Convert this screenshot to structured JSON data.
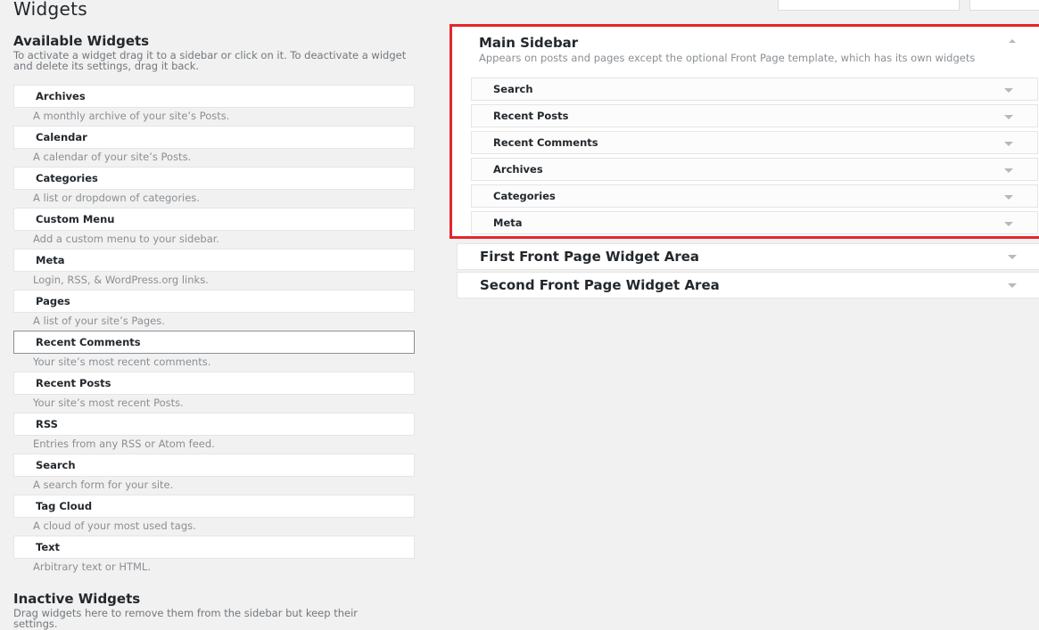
{
  "page": {
    "title": "Widgets"
  },
  "available": {
    "heading": "Available Widgets",
    "description": "To activate a widget drag it to a sidebar or click on it. To deactivate a widget and delete its settings, drag it back.",
    "widgets": [
      {
        "name": "Archives",
        "description": "A monthly archive of your site’s Posts."
      },
      {
        "name": "Calendar",
        "description": "A calendar of your site’s Posts."
      },
      {
        "name": "Categories",
        "description": "A list or dropdown of categories."
      },
      {
        "name": "Custom Menu",
        "description": "Add a custom menu to your sidebar."
      },
      {
        "name": "Meta",
        "description": "Login, RSS, & WordPress.org links."
      },
      {
        "name": "Pages",
        "description": "A list of your site’s Pages."
      },
      {
        "name": "Recent Comments",
        "description": "Your site’s most recent comments."
      },
      {
        "name": "Recent Posts",
        "description": "Your site’s most recent Posts."
      },
      {
        "name": "RSS",
        "description": "Entries from any RSS or Atom feed."
      },
      {
        "name": "Search",
        "description": "A search form for your site."
      },
      {
        "name": "Tag Cloud",
        "description": "A cloud of your most used tags."
      },
      {
        "name": "Text",
        "description": "Arbitrary text or HTML."
      }
    ]
  },
  "inactive": {
    "heading": "Inactive Widgets",
    "description": "Drag widgets here to remove them from the sidebar but keep their settings."
  },
  "main_sidebar": {
    "title": "Main Sidebar",
    "description": "Appears on posts and pages except the optional Front Page template, which has its own widgets",
    "highlight_color": "#e3262c",
    "items": [
      "Search",
      "Recent Posts",
      "Recent Comments",
      "Archives",
      "Categories",
      "Meta"
    ]
  },
  "widget_areas": {
    "first": "First Front Page Widget Area",
    "second": "Second Front Page Widget Area"
  }
}
